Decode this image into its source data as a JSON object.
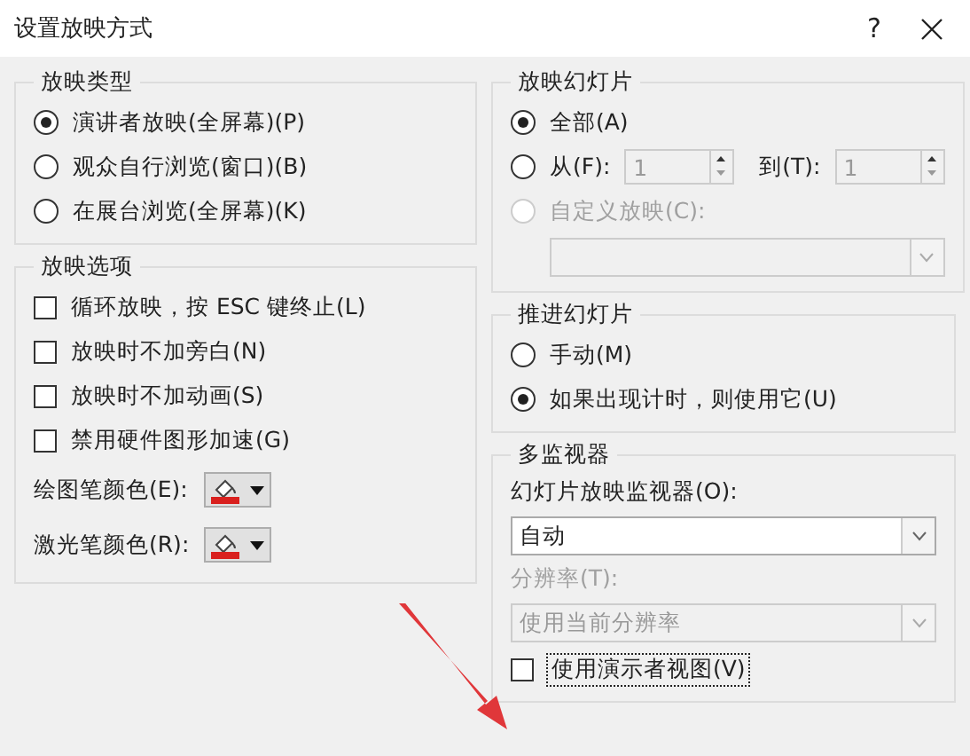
{
  "window": {
    "title": "设置放映方式",
    "help": "?"
  },
  "left_groups": [
    {
      "title": "放映类型",
      "items": [
        {
          "kind": "radio",
          "label": "演讲者放映(全屏幕)(P)",
          "selected": true,
          "disabled": false
        },
        {
          "kind": "radio",
          "label": "观众自行浏览(窗口)(B)",
          "selected": false,
          "disabled": false
        },
        {
          "kind": "radio",
          "label": "在展台浏览(全屏幕)(K)",
          "selected": false,
          "disabled": false
        }
      ]
    },
    {
      "title": "放映选项",
      "items": [
        {
          "kind": "checkbox",
          "label": "循环放映，按 ESC 键终止(L)",
          "checked": false,
          "focused": false
        },
        {
          "kind": "checkbox",
          "label": "放映时不加旁白(N)",
          "checked": false,
          "focused": false
        },
        {
          "kind": "checkbox",
          "label": "放映时不加动画(S)",
          "checked": false,
          "focused": false
        },
        {
          "kind": "checkbox",
          "label": "禁用硬件图形加速(G)",
          "checked": false,
          "focused": false
        },
        {
          "kind": "color",
          "label": "绘图笔颜色(E):"
        },
        {
          "kind": "color",
          "label": "激光笔颜色(R):"
        }
      ]
    }
  ],
  "right_groups": [
    {
      "title": "放映幻灯片",
      "items": [
        {
          "kind": "radio",
          "label": "全部(A)",
          "selected": true,
          "disabled": false
        },
        {
          "kind": "range",
          "label": "从(F):",
          "selected": false,
          "disabled": false,
          "from_value": "1",
          "to_label": "到(T):",
          "to_value": "1"
        },
        {
          "kind": "radio",
          "label": "自定义放映(C):",
          "selected": false,
          "disabled": true
        },
        {
          "kind": "dropdown",
          "disabled": true
        }
      ]
    },
    {
      "title": "推进幻灯片",
      "items": [
        {
          "kind": "radio",
          "label": "手动(M)",
          "selected": false,
          "disabled": false
        },
        {
          "kind": "radio",
          "label": "如果出现计时，则使用它(U)",
          "selected": true,
          "disabled": false
        }
      ]
    },
    {
      "title": "多监视器",
      "items": [
        {
          "kind": "label",
          "text": "幻灯片放映监视器(O):",
          "disabled": false
        },
        {
          "kind": "dropdown",
          "value": "自动",
          "disabled": false
        },
        {
          "kind": "label",
          "text": "分辨率(T):",
          "disabled": true
        },
        {
          "kind": "dropdown",
          "value": "使用当前分辨率",
          "disabled": true
        },
        {
          "kind": "checkbox",
          "label": "使用演示者视图(V)",
          "checked": false,
          "focused": true
        }
      ]
    }
  ]
}
